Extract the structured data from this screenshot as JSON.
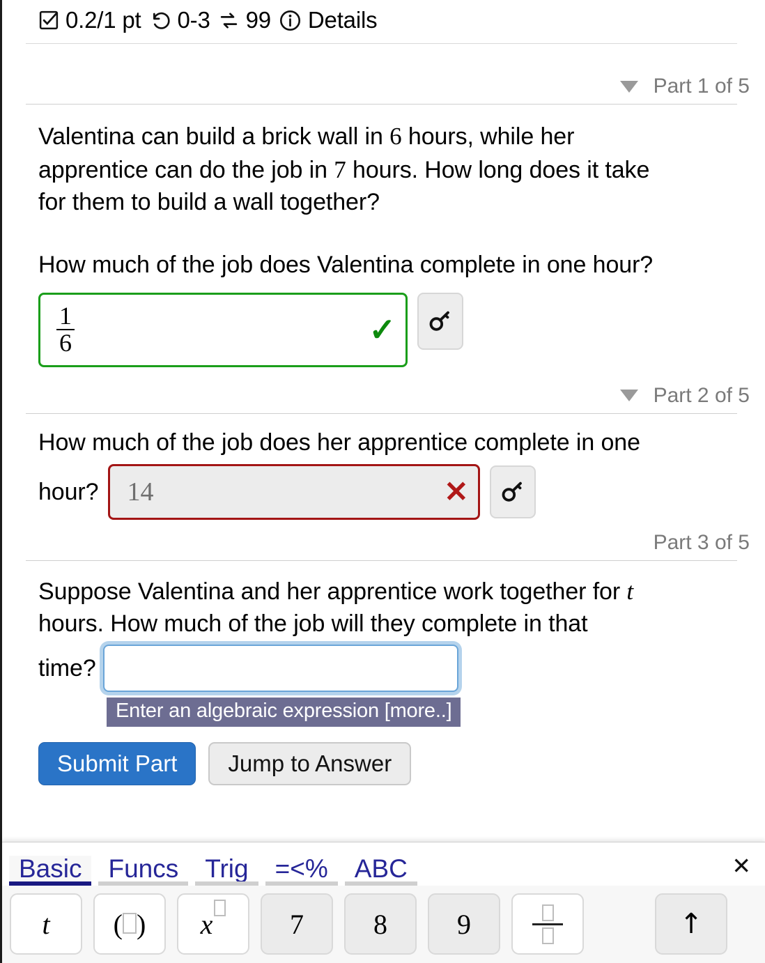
{
  "header": {
    "score": "0.2/1 pt",
    "attempts": "0-3",
    "exchanges": "99",
    "details_label": "Details",
    "icons": {
      "checkbox": "checkbox-checked-icon",
      "retry": "rotate-ccw-icon",
      "swap": "swap-arrows-icon",
      "info": "info-circle-icon"
    }
  },
  "parts": [
    {
      "label": "Part 1 of 5",
      "has_toggle": true,
      "prompt_lines": [
        "Valentina can build a brick wall in 6 hours, while her",
        "apprentice can do the job in 7 hours. How long does it take",
        "for them to build a wall together?"
      ],
      "question": "How much of the job does Valentina complete in one hour?",
      "answer": {
        "numerator": "1",
        "denominator": "6"
      },
      "status": "correct",
      "mark": "✓",
      "key_icon": "key-icon"
    },
    {
      "label": "Part 2 of 5",
      "has_toggle": true,
      "question_line1": "How much of the job does her apprentice complete in one",
      "question_line2": "hour?",
      "answer_value": "14",
      "status": "incorrect",
      "mark": "✕",
      "key_icon": "key-icon"
    },
    {
      "label": "Part 3 of 5",
      "has_toggle": false,
      "prompt_line1": "Suppose Valentina and her apprentice work together for ",
      "prompt_var": "t",
      "prompt_line2": "hours. How much of the job will they complete in that",
      "prompt_line3": "time?",
      "answer_value": "",
      "tooltip": "Enter an algebraic expression [more..]",
      "status": "active"
    }
  ],
  "actions": {
    "submit_label": "Submit Part",
    "jump_label": "Jump to Answer"
  },
  "math_keyboard": {
    "tabs": [
      {
        "label": "Basic",
        "active": true
      },
      {
        "label": "Funcs",
        "active": false
      },
      {
        "label": "Trig",
        "active": false
      },
      {
        "label": "=<%",
        "active": false
      },
      {
        "label": "ABC",
        "active": false
      }
    ],
    "close_label": "✕",
    "keys": [
      {
        "name": "variable-t",
        "label": "t",
        "style": "white",
        "kind": "italic"
      },
      {
        "name": "parentheses",
        "label": "",
        "style": "white",
        "kind": "parens"
      },
      {
        "name": "exponent",
        "label": "",
        "style": "white",
        "kind": "power"
      },
      {
        "name": "digit-7",
        "label": "7",
        "style": "grey",
        "kind": "plain"
      },
      {
        "name": "digit-8",
        "label": "8",
        "style": "grey",
        "kind": "plain"
      },
      {
        "name": "digit-9",
        "label": "9",
        "style": "grey",
        "kind": "plain"
      },
      {
        "name": "fraction",
        "label": "",
        "style": "white",
        "kind": "fraction"
      },
      {
        "name": "up-arrow",
        "label": "↑",
        "style": "grey",
        "kind": "arrow"
      }
    ]
  },
  "colors": {
    "correct_green": "#1a9e1a",
    "incorrect_red": "#a31515",
    "primary_blue": "#2a74c7",
    "tab_navy": "#262698",
    "tooltip_bg": "#6d6d92"
  }
}
